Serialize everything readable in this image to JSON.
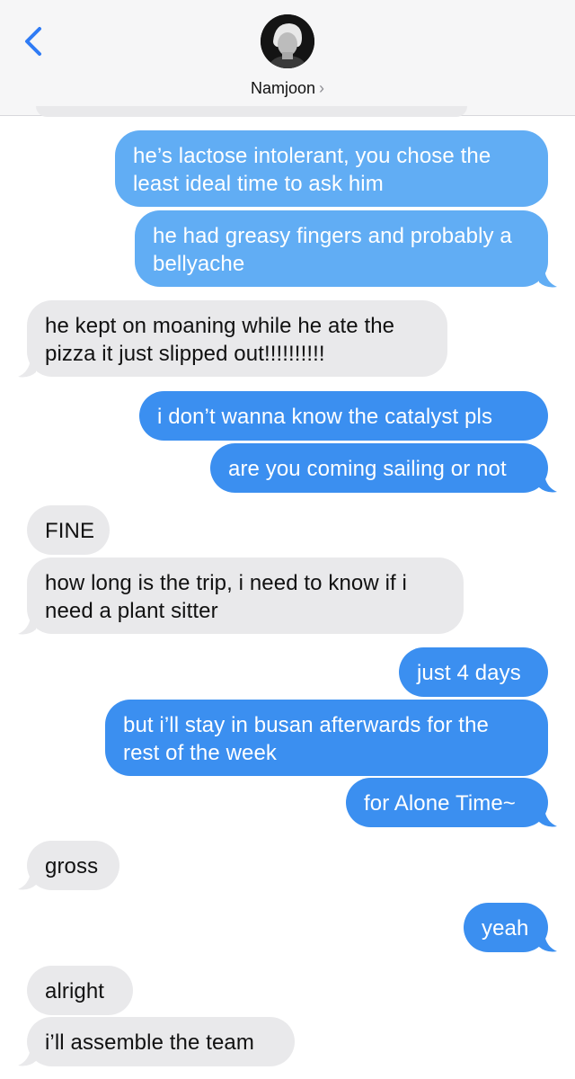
{
  "header": {
    "contact_name": "Namjoon",
    "chevron": "›",
    "back_icon": "chevron-left-icon"
  },
  "colors": {
    "sent_bubble": "#3b8ff0",
    "sent_bubble_top": "#61adf4",
    "received_bubble": "#e9e9eb",
    "accent": "#2f7bf5"
  },
  "messages": [
    {
      "from": "me",
      "text": "he’s lactose intolerant, you chose the least ideal time to ask him"
    },
    {
      "from": "me",
      "text": "he had greasy fingers and probably a bellyache"
    },
    {
      "from": "them",
      "text": "he kept on moaning while he ate the pizza it just slipped out!!!!!!!!!!"
    },
    {
      "from": "me",
      "text": "i don’t wanna know the catalyst pls"
    },
    {
      "from": "me",
      "text": "are you coming sailing or not"
    },
    {
      "from": "them",
      "text": "FINE"
    },
    {
      "from": "them",
      "text": "how long is the trip, i need to know if i need a plant sitter"
    },
    {
      "from": "me",
      "text": "just 4 days"
    },
    {
      "from": "me",
      "text": "but i’ll stay in busan afterwards for the rest of the week"
    },
    {
      "from": "me",
      "text": "for Alone Time~"
    },
    {
      "from": "them",
      "text": "gross"
    },
    {
      "from": "me",
      "text": "yeah"
    },
    {
      "from": "them",
      "text": "alright"
    },
    {
      "from": "them",
      "text": "i’ll assemble the team"
    }
  ]
}
